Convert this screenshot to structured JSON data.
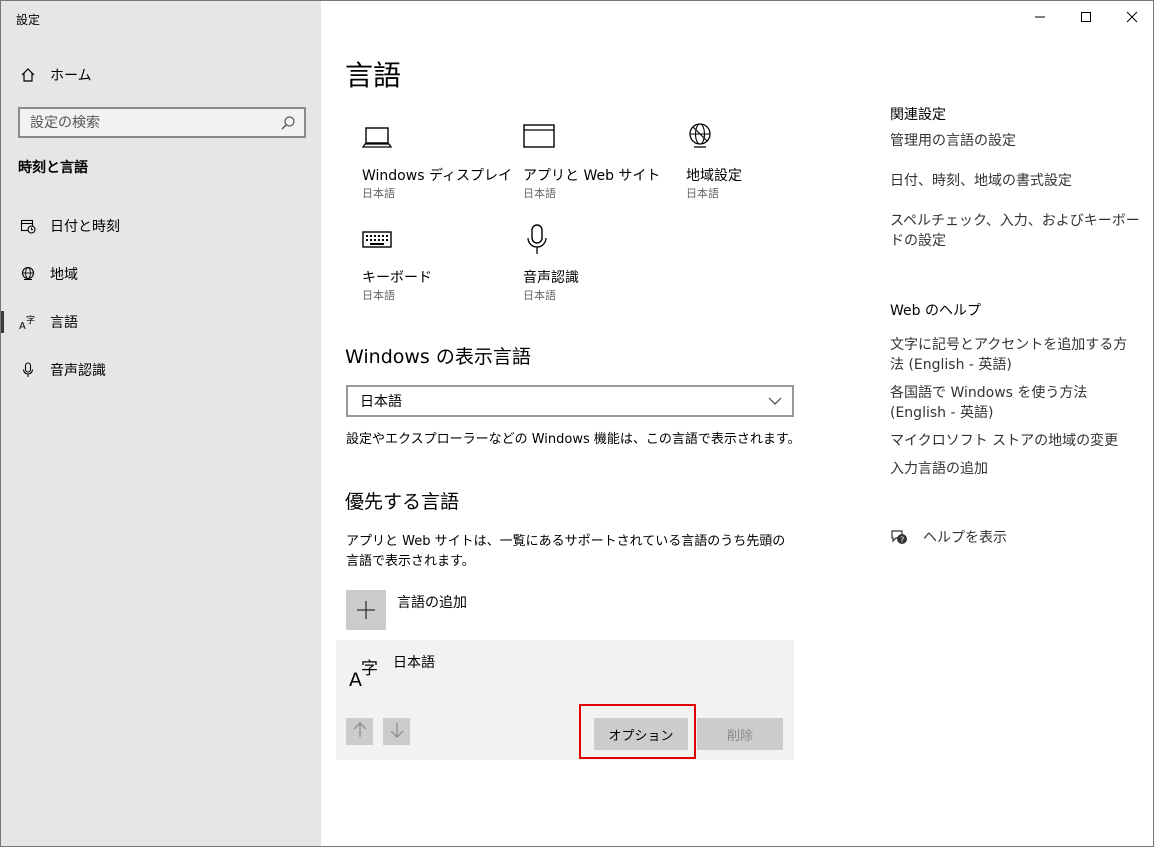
{
  "window": {
    "title": "設定"
  },
  "sidebar": {
    "home_label": "ホーム",
    "search_placeholder": "設定の検索",
    "section_title": "時刻と言語",
    "items": [
      {
        "label": "日付と時刻",
        "icon": "calendar-clock-icon"
      },
      {
        "label": "地域",
        "icon": "globe-icon"
      },
      {
        "label": "言語",
        "icon": "language-icon",
        "active": true
      },
      {
        "label": "音声認識",
        "icon": "microphone-icon"
      }
    ]
  },
  "main": {
    "title": "言語",
    "tiles": [
      {
        "label": "Windows ディスプレイ",
        "sub": "日本語",
        "icon": "laptop-icon"
      },
      {
        "label": "アプリと Web サイト",
        "sub": "日本語",
        "icon": "browser-window-icon"
      },
      {
        "label": "地域設定",
        "sub": "日本語",
        "icon": "globe-settings-icon"
      },
      {
        "label": "キーボード",
        "sub": "日本語",
        "icon": "keyboard-icon"
      },
      {
        "label": "音声認識",
        "sub": "日本語",
        "icon": "microphone-icon"
      }
    ],
    "display_language": {
      "heading": "Windows の表示言語",
      "selected": "日本語",
      "description": "設定やエクスプローラーなどの Windows 機能は、この言語で表示されます。"
    },
    "preferred_language": {
      "heading": "優先する言語",
      "description": "アプリと Web サイトは、一覧にあるサポートされている言語のうち先頭の言語で表示されます。",
      "add_label": "言語の追加",
      "item_name": "日本語",
      "options_label": "オプション",
      "remove_label": "削除"
    }
  },
  "right": {
    "related_heading": "関連設定",
    "related_links": [
      "管理用の言語の設定",
      "日付、時刻、地域の書式設定",
      "スペルチェック、入力、およびキーボードの設定"
    ],
    "web_help_heading": "Web のヘルプ",
    "web_help_links": [
      "文字に記号とアクセントを追加する方法 (English - 英語)",
      "各国語で Windows を使う方法 (English - 英語)",
      "マイクロソフト ストアの地域の変更",
      "入力言語の追加"
    ],
    "help_label": "ヘルプを表示"
  },
  "colors": {
    "highlight": "#e00000",
    "sidebar_bg": "#e6e6e6"
  }
}
